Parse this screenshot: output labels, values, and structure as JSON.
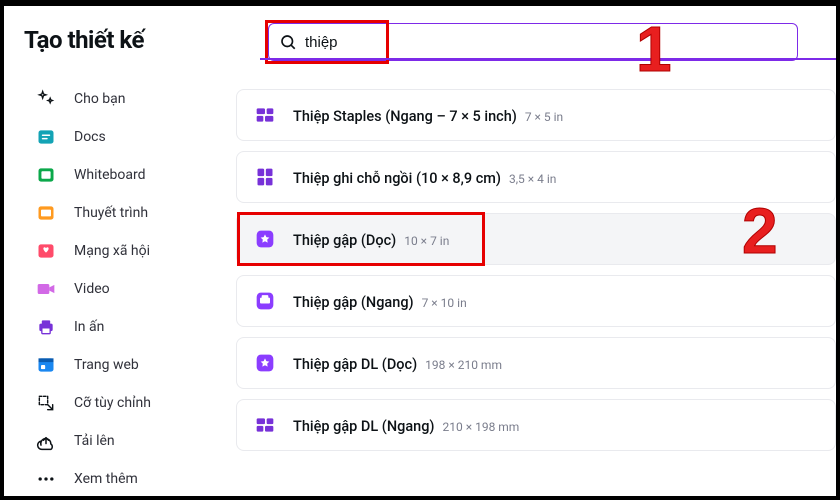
{
  "sidebar": {
    "title": "Tạo thiết kế",
    "items": [
      {
        "label": "Cho bạn",
        "name": "sidebar-item-for-you",
        "icon": "sparkle"
      },
      {
        "label": "Docs",
        "name": "sidebar-item-docs",
        "icon": "docs"
      },
      {
        "label": "Whiteboard",
        "name": "sidebar-item-whiteboard",
        "icon": "whiteboard"
      },
      {
        "label": "Thuyết trình",
        "name": "sidebar-item-presentation",
        "icon": "presentation"
      },
      {
        "label": "Mạng xã hội",
        "name": "sidebar-item-social",
        "icon": "social"
      },
      {
        "label": "Video",
        "name": "sidebar-item-video",
        "icon": "video"
      },
      {
        "label": "In ấn",
        "name": "sidebar-item-print",
        "icon": "printer"
      },
      {
        "label": "Trang web",
        "name": "sidebar-item-website",
        "icon": "website"
      },
      {
        "label": "Cỡ tùy chỉnh",
        "name": "sidebar-item-custom-size",
        "icon": "customsize"
      },
      {
        "label": "Tải lên",
        "name": "sidebar-item-upload",
        "icon": "upload"
      },
      {
        "label": "Xem thêm",
        "name": "sidebar-item-more",
        "icon": "more"
      }
    ]
  },
  "search": {
    "value": "thiệp"
  },
  "results": [
    {
      "title": "Thiệp Staples (Ngang – 7 × 5 inch)",
      "dim": "7 × 5 in",
      "icon": "tilesH",
      "highlight": false,
      "name": "result-staples-landscape"
    },
    {
      "title": "Thiệp ghi chỗ ngồi (10 × 8,9 cm)",
      "dim": "3,5 × 4 in",
      "icon": "tilesV",
      "highlight": false,
      "name": "result-place-card"
    },
    {
      "title": "Thiệp gập (Dọc)",
      "dim": "10 × 7 in",
      "icon": "starSq",
      "highlight": true,
      "name": "result-folded-portrait"
    },
    {
      "title": "Thiệp gập (Ngang)",
      "dim": "7 × 10 in",
      "icon": "printSq",
      "highlight": false,
      "name": "result-folded-landscape"
    },
    {
      "title": "Thiệp gập DL (Dọc)",
      "dim": "198 × 210 mm",
      "icon": "starSq",
      "highlight": false,
      "name": "result-folded-dl-portrait"
    },
    {
      "title": "Thiệp gập DL (Ngang)",
      "dim": "210 × 198 mm",
      "icon": "tilesH",
      "highlight": false,
      "name": "result-folded-dl-landscape"
    }
  ],
  "annotations": {
    "one": "1",
    "two": "2"
  },
  "colors": {
    "brand": "#7d2ae8",
    "anno": "#e60000"
  }
}
